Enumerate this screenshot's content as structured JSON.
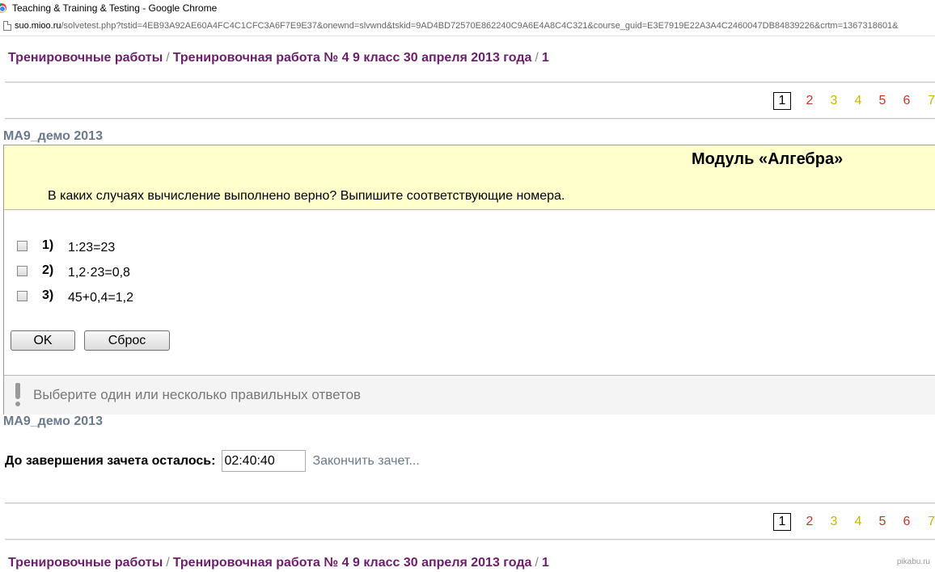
{
  "window": {
    "title": "Teaching & Training & Testing - Google Chrome"
  },
  "address": {
    "host": "suo.mioo.ru",
    "path": "/solvetest.php?tstid=4EB93A92AE60A4FC4C1CFC3A6F7E9E37&onewnd=slvwnd&tskid=9AD4BD72570E862240C9A6E4A8C4C321&course_guid=E3E7919E22A3A4C2460047DB84839226&crtm=1367318601&"
  },
  "breadcrumb": {
    "root": "Тренировочные работы",
    "work": "Тренировочная работа № 4 9 класс 30 апреля 2013 года",
    "current": "1",
    "separator": "/"
  },
  "pager": {
    "pages": [
      {
        "label": "1",
        "state": "current"
      },
      {
        "label": "2",
        "state": "red"
      },
      {
        "label": "3",
        "state": "yellow"
      },
      {
        "label": "4",
        "state": "yellow"
      },
      {
        "label": "5",
        "state": "red"
      },
      {
        "label": "6",
        "state": "red"
      },
      {
        "label": "7",
        "state": "yellow"
      }
    ]
  },
  "test": {
    "name": "МА9_демо 2013"
  },
  "question": {
    "module_title": "Модуль «Алгебра»",
    "text": "В каких случаях вычисление выполнено верно? Выпишите соответствующие номера.",
    "options": [
      {
        "num": "1)",
        "text": "1:23=23"
      },
      {
        "num": "2)",
        "text": "1,2·23=0,8"
      },
      {
        "num": "3)",
        "text": "45+0,4=1,2"
      }
    ],
    "ok_label": "OK",
    "reset_label": "Сброс",
    "hint": "Выберите один или несколько правильных ответов"
  },
  "timer": {
    "label": "До завершения зачета осталось:",
    "value": "02:40:40",
    "finish_link": "Закончить зачет..."
  },
  "watermark": "pikabu.ru"
}
